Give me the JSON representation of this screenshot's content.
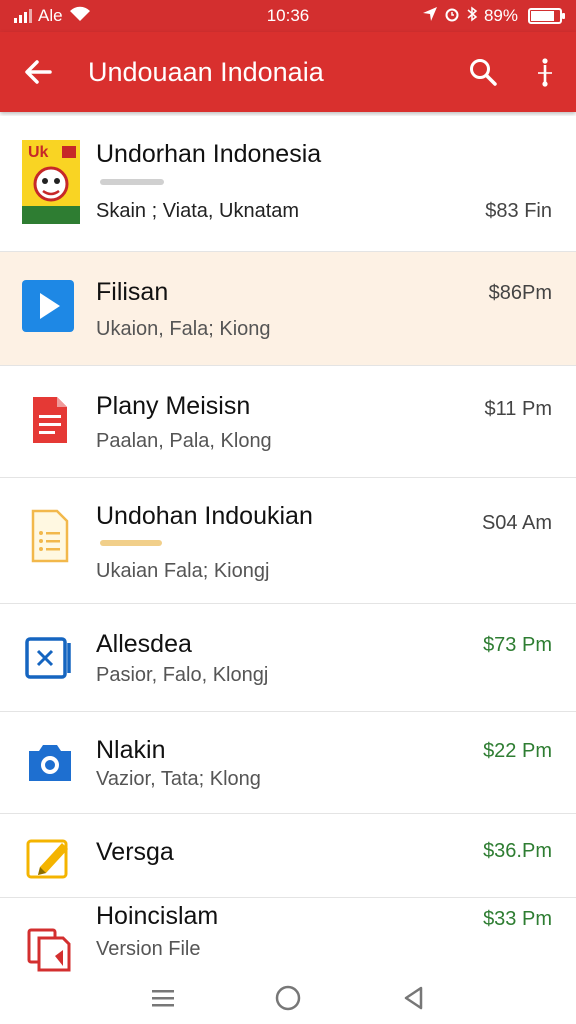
{
  "status_bar": {
    "carrier": "Ale",
    "time": "10:36",
    "battery": "89%",
    "icons": [
      "signal-icon",
      "wifi-icon",
      "location-icon",
      "alarm-icon",
      "bluetooth-icon",
      "battery-icon"
    ]
  },
  "app_bar": {
    "title": "Undouaan Indonaia",
    "icons": [
      "back-arrow-icon",
      "search-icon",
      "overflow-icon"
    ],
    "color": "#d9302e"
  },
  "list": {
    "items": [
      {
        "name": "Undorhan Indonesia",
        "subtitle": "Skain ; Viata, Uknatam",
        "price": "$83 Fin",
        "icon": "comic-thumbnail-icon",
        "thumb_label": "Uk"
      },
      {
        "name": "Filisan",
        "subtitle": "Ukaion, Fala; Kiong",
        "price": "$86Pm",
        "icon": "play-icon",
        "highlighted": true
      },
      {
        "name": "Plany Meisisn",
        "subtitle": "Paalan, Pala, Klong",
        "price": "$11 Pm",
        "icon": "document-icon"
      },
      {
        "name": "Undohan Indoukian",
        "subtitle": "Ukaian Fala; Kiongj",
        "price": "S04 Am",
        "icon": "notes-icon"
      },
      {
        "name": "Allesdea",
        "subtitle": "Pasior, Falo, Klongj",
        "price": "$73 Pm",
        "icon": "image-gallery-icon"
      },
      {
        "name": "Nlakin",
        "subtitle": "Vazior, Tata; Klong",
        "price": "$22 Pm",
        "icon": "camera-icon"
      },
      {
        "name": "Versga",
        "subtitle": "",
        "price": "$36.Pm",
        "icon": "pencil-icon"
      },
      {
        "name": "Hoincislam",
        "subtitle": "Version File",
        "price": "$33 Pm",
        "icon": "copy-files-icon"
      }
    ]
  },
  "nav_bar": {
    "icons": [
      "menu-icon",
      "home-circle-icon",
      "back-triangle-icon"
    ]
  },
  "colors": {
    "accent": "#d32f2f",
    "highlight": "#fdf1e4",
    "price_green": "#2e7d32"
  }
}
